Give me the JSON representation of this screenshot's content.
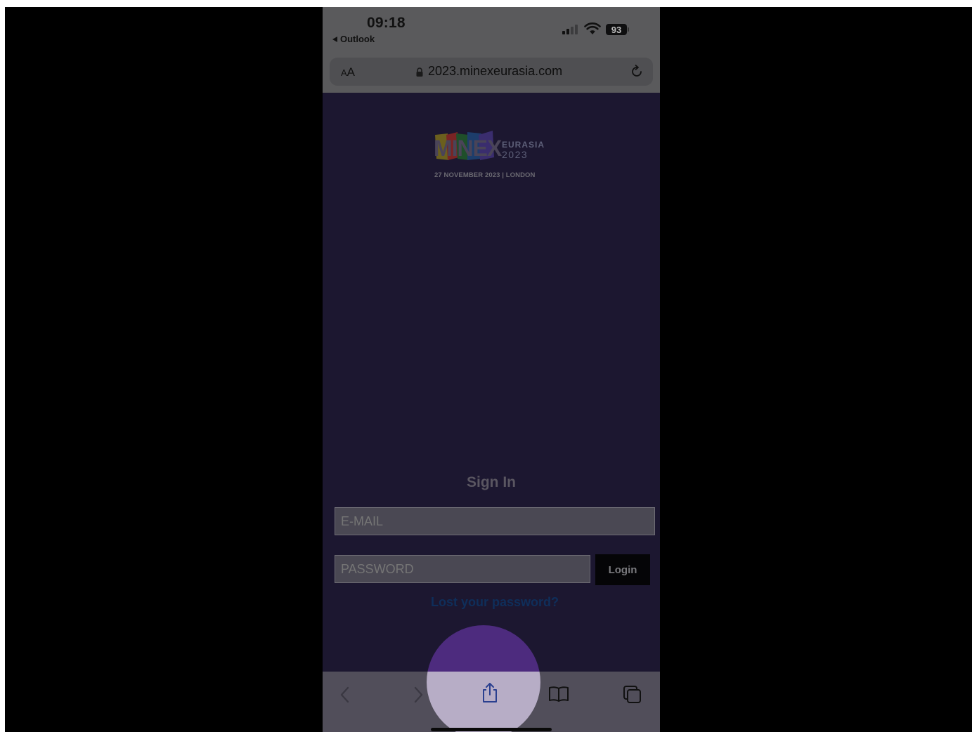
{
  "status_bar": {
    "time": "09:18",
    "back_app": "Outlook",
    "battery": "93",
    "icons": [
      "signal-icon",
      "wifi-icon",
      "battery-icon"
    ]
  },
  "browser": {
    "text_size_button": {
      "small": "A",
      "large": "A"
    },
    "url": "2023.minexeurasia.com",
    "icons": [
      "lock-icon",
      "reload-icon"
    ]
  },
  "event": {
    "logo_word": "MINEX",
    "logo_sub1": "EURASIA",
    "logo_sub2": "2023",
    "tagline": "27 NOVEMBER 2023  |  LONDON"
  },
  "login": {
    "title": "Sign In",
    "email_placeholder": "E-MAIL",
    "password_placeholder": "PASSWORD",
    "login_label": "Login",
    "lost_password": "Lost your password?"
  },
  "toolbar": {
    "items": [
      "back-icon",
      "forward-icon",
      "share-icon",
      "bookmarks-icon",
      "tabs-icon"
    ]
  },
  "colors": {
    "page_background": "#1c1730",
    "browser_chrome": "#5a5a5c",
    "touch_indicator": "#b7adc6",
    "link": "#0f2e5a"
  }
}
